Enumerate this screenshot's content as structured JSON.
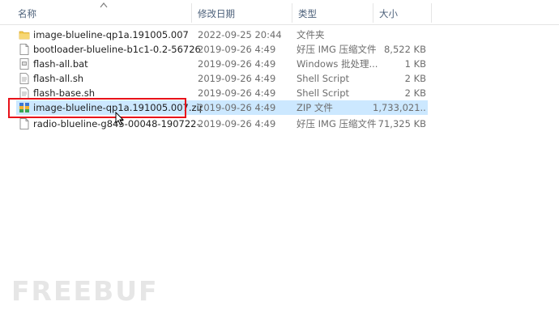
{
  "columns": {
    "name": "名称",
    "date": "修改日期",
    "type": "类型",
    "size": "大小"
  },
  "files": [
    {
      "name": "image-blueline-qp1a.191005.007",
      "date": "2022-09-25 20:44",
      "type": "文件夹",
      "size": "",
      "icon": "folder-icon"
    },
    {
      "name": "bootloader-blueline-b1c1-0.2-56726...",
      "date": "2019-09-26 4:49",
      "type": "好压 IMG 压缩文件",
      "size": "8,522 KB",
      "icon": "file-icon"
    },
    {
      "name": "flash-all.bat",
      "date": "2019-09-26 4:49",
      "type": "Windows 批处理...",
      "size": "1 KB",
      "icon": "batch-file-icon"
    },
    {
      "name": "flash-all.sh",
      "date": "2019-09-26 4:49",
      "type": "Shell Script",
      "size": "2 KB",
      "icon": "script-file-icon"
    },
    {
      "name": "flash-base.sh",
      "date": "2019-09-26 4:49",
      "type": "Shell Script",
      "size": "2 KB",
      "icon": "script-file-icon"
    },
    {
      "name": "image-blueline-qp1a.191005.007.zip",
      "date": "2019-09-26 4:49",
      "type": "ZIP 文件",
      "size": "1,733,021...",
      "icon": "zip-archive-icon",
      "selected": true
    },
    {
      "name": "radio-blueline-g845-00048-190722-...",
      "date": "2019-09-26 4:49",
      "type": "好压 IMG 压缩文件",
      "size": "71,325 KB",
      "icon": "file-icon"
    }
  ],
  "watermark": "FREEBUF",
  "colors": {
    "selection": "#cce8ff",
    "highlight_border": "#e8121a",
    "folder": "#f2c94c"
  }
}
